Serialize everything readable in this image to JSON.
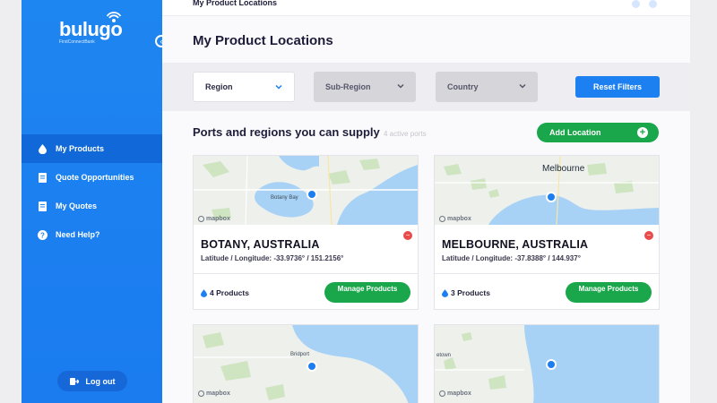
{
  "brand": {
    "name": "bulugo",
    "tagline": "FirstConnectBank"
  },
  "topbar": {
    "title": "My Product Locations"
  },
  "page": {
    "title": "My Product Locations"
  },
  "sidebar": {
    "items": [
      {
        "label": "My Products",
        "icon": "drop-icon",
        "active": true
      },
      {
        "label": "Quote Opportunities",
        "icon": "document-icon",
        "active": false
      },
      {
        "label": "My Quotes",
        "icon": "document-icon",
        "active": false
      },
      {
        "label": "Need Help?",
        "icon": "help-icon",
        "active": false
      }
    ],
    "logout_label": "Log out"
  },
  "filters": {
    "region": "Region",
    "sub_region": "Sub-Region",
    "country": "Country",
    "reset_label": "Reset Filters"
  },
  "section": {
    "title": "Ports and regions you can supply",
    "count": "4 active ports",
    "add_label": "Add Location"
  },
  "cards": [
    {
      "name": "BOTANY, AUSTRALIA",
      "latlng": "Latitude / Longitude: -33.9736° / 151.2156°",
      "products": "4 Products",
      "manage_label": "Manage Products",
      "map_label": "Botany Bay",
      "map_attribution": "mapbox"
    },
    {
      "name": "MELBOURNE, AUSTRALIA",
      "latlng": "Latitude / Longitude: -37.8388° / 144.937°",
      "products": "3 Products",
      "manage_label": "Manage Products",
      "map_label": "Melbourne",
      "map_attribution": "mapbox"
    },
    {
      "map_label": "Bridport",
      "map_attribution": "mapbox"
    },
    {
      "map_label": "etown",
      "map_attribution": "mapbox"
    }
  ],
  "colors": {
    "sidebar": "#1e86f0",
    "sidebar_active": "#1168d8",
    "primary": "#1c80f0",
    "green": "#1aa64a",
    "danger": "#e94b4b",
    "water": "#a8d2f5",
    "land": "#eef0ec"
  }
}
